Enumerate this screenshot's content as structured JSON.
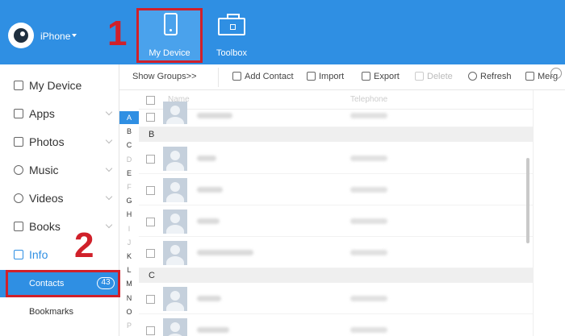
{
  "header": {
    "device_selector": "iPhone",
    "buttons": {
      "my_device": "My Device",
      "toolbox": "Toolbox"
    }
  },
  "annotations": [
    "1",
    "2"
  ],
  "sidebar": {
    "items": [
      {
        "label": "My Device",
        "icon": "phone-icon"
      },
      {
        "label": "Apps",
        "icon": "grid-icon"
      },
      {
        "label": "Photos",
        "icon": "image-icon"
      },
      {
        "label": "Music",
        "icon": "music-icon"
      },
      {
        "label": "Videos",
        "icon": "video-icon"
      },
      {
        "label": "Books",
        "icon": "book-icon"
      },
      {
        "label": "Info",
        "icon": "info-icon"
      }
    ],
    "sub_items": [
      {
        "label": "Contacts",
        "badge": "43",
        "selected": true
      },
      {
        "label": "Bookmarks"
      }
    ]
  },
  "toolbar": {
    "show_groups": "Show Groups>>",
    "add_contact": "Add Contact",
    "import": "Import",
    "export": "Export",
    "delete": "Delete",
    "refresh": "Refresh",
    "merge": "Merg"
  },
  "alphabet": [
    "A",
    "B",
    "C",
    "D",
    "E",
    "F",
    "G",
    "H",
    "I",
    "J",
    "K",
    "L",
    "M",
    "N",
    "O",
    "P"
  ],
  "alphabet_dim": [
    "D",
    "F",
    "I",
    "J",
    "P"
  ],
  "alphabet_active": "A",
  "list": {
    "columns": {
      "name": "Name",
      "telephone": "Telephone"
    },
    "groups": [
      "B",
      "C"
    ]
  },
  "colors": {
    "accent": "#2f8fe3",
    "annotation": "#d0202a"
  }
}
